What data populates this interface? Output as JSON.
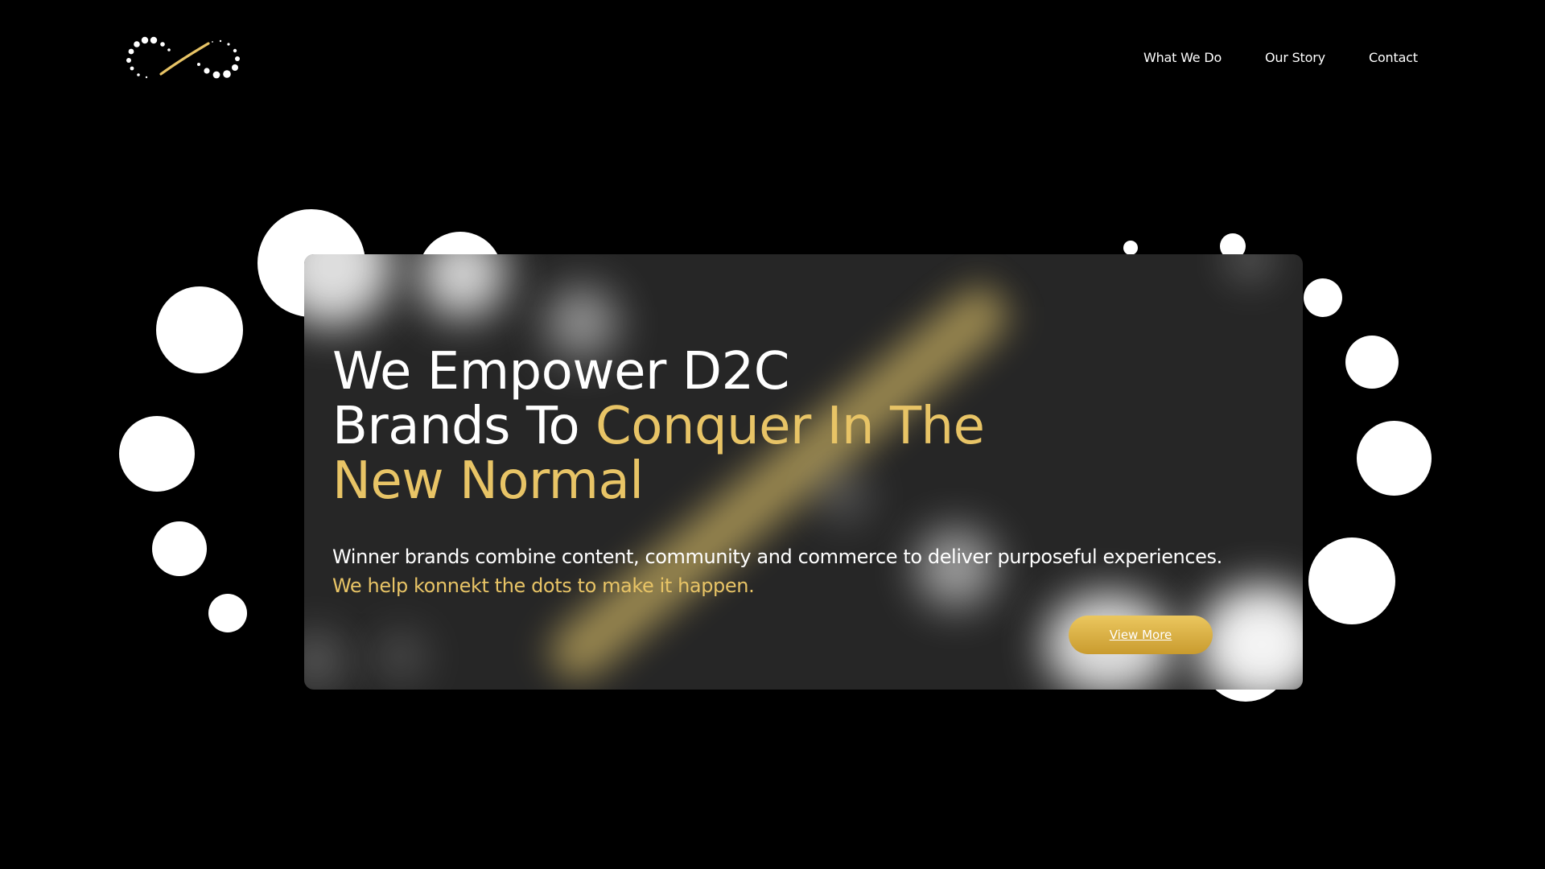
{
  "colors": {
    "background": "#000000",
    "card": "#262626",
    "accent_gold": "#e8c466",
    "button_gold": "#d6ad44",
    "text_white": "#ffffff"
  },
  "header": {
    "logo": "infinity-dots-logo",
    "nav": [
      {
        "label": "What We Do"
      },
      {
        "label": "Our Story"
      },
      {
        "label": "Contact"
      }
    ]
  },
  "hero": {
    "title_line1": "We Empower D2C",
    "title_line2_white": "Brands To ",
    "title_line2_gold": "Conquer In The",
    "title_line3_gold": "New Normal",
    "subtitle": "Winner brands combine content, community and commerce to deliver purposeful experiences.",
    "subtitle_gold": "We help konnekt the dots to make it happen.",
    "cta_label": "View More"
  }
}
